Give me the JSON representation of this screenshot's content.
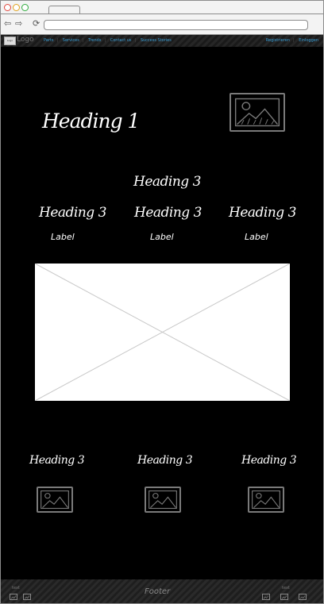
{
  "navbar": {
    "logo_box": "Logo",
    "logo_text": "Logo",
    "links": [
      "Parts",
      "Services",
      "Trends",
      "Contact us",
      "Success Stories"
    ],
    "right_links": [
      "Registrieren",
      "Einloggen"
    ]
  },
  "hero": {
    "heading": "Heading 1",
    "image_icon": "image-icon"
  },
  "section": {
    "heading": "Heading 3",
    "columns": [
      {
        "heading": "Heading 3",
        "label": "Label"
      },
      {
        "heading": "Heading 3",
        "label": "Label"
      },
      {
        "heading": "Heading 3",
        "label": "Label"
      }
    ]
  },
  "gallery": [
    {
      "heading": "Heading 3",
      "icon": "image-icon"
    },
    {
      "heading": "Heading 3",
      "icon": "image-icon"
    },
    {
      "heading": "Heading 3",
      "icon": "image-icon"
    }
  ],
  "footer": {
    "title": "Footer",
    "left_text": "text",
    "right_text": "text"
  },
  "colors": {
    "background": "#000000",
    "link": "#3aa0d8",
    "text": "#ffffff"
  }
}
